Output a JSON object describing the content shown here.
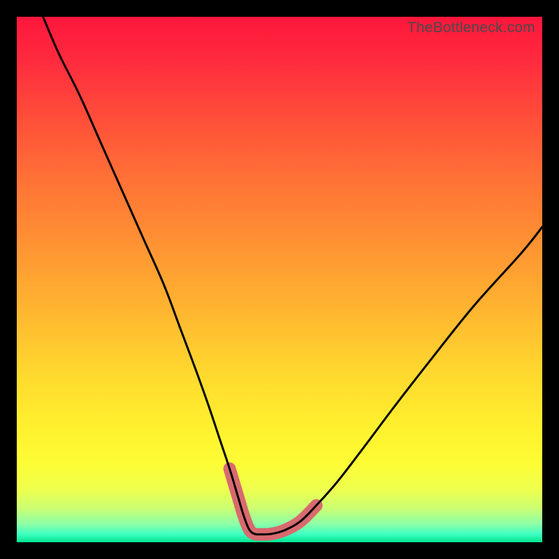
{
  "watermark": "TheBottleneck.com",
  "gradient": {
    "stops": [
      {
        "offset": 0.0,
        "color": "#ff163b"
      },
      {
        "offset": 0.08,
        "color": "#ff2a3e"
      },
      {
        "offset": 0.18,
        "color": "#ff4a3a"
      },
      {
        "offset": 0.3,
        "color": "#ff6f36"
      },
      {
        "offset": 0.42,
        "color": "#ff8f33"
      },
      {
        "offset": 0.55,
        "color": "#ffb330"
      },
      {
        "offset": 0.68,
        "color": "#ffd92e"
      },
      {
        "offset": 0.78,
        "color": "#fff02e"
      },
      {
        "offset": 0.85,
        "color": "#fdfd35"
      },
      {
        "offset": 0.9,
        "color": "#eeff4e"
      },
      {
        "offset": 0.935,
        "color": "#ccff72"
      },
      {
        "offset": 0.965,
        "color": "#8dffa7"
      },
      {
        "offset": 0.985,
        "color": "#3effc1"
      },
      {
        "offset": 1.0,
        "color": "#00e58f"
      }
    ]
  },
  "chart_data": {
    "type": "line",
    "title": "",
    "xlabel": "",
    "ylabel": "",
    "xlim": [
      0,
      100
    ],
    "ylim": [
      0,
      100
    ],
    "series": [
      {
        "name": "bottleneck-curve",
        "x": [
          5,
          8,
          12,
          16,
          20,
          24,
          28,
          31,
          34,
          36.5,
          38.5,
          40.5,
          42,
          43.2,
          44.2,
          45.2,
          46.5,
          48.5,
          51,
          54,
          57,
          61,
          66,
          72,
          79,
          87,
          96,
          100
        ],
        "y": [
          100,
          93,
          85,
          76,
          67,
          58,
          49,
          41,
          33,
          26,
          20,
          14,
          9,
          5,
          2.5,
          1.6,
          1.5,
          1.6,
          2.3,
          4.0,
          7.0,
          11.5,
          18,
          26,
          35,
          45,
          55,
          60
        ]
      }
    ],
    "markers": {
      "name": "trough-markers",
      "color": "#d86a6f",
      "radius": 8,
      "points": [
        {
          "x": 40.5,
          "y": 14
        },
        {
          "x": 42.0,
          "y": 9
        },
        {
          "x": 43.2,
          "y": 5
        },
        {
          "x": 44.2,
          "y": 2.5
        },
        {
          "x": 45.2,
          "y": 1.6
        },
        {
          "x": 46.5,
          "y": 1.5
        },
        {
          "x": 48.5,
          "y": 1.6
        },
        {
          "x": 51.0,
          "y": 2.3
        },
        {
          "x": 54.0,
          "y": 4.0
        },
        {
          "x": 57.0,
          "y": 7.0
        }
      ]
    }
  }
}
